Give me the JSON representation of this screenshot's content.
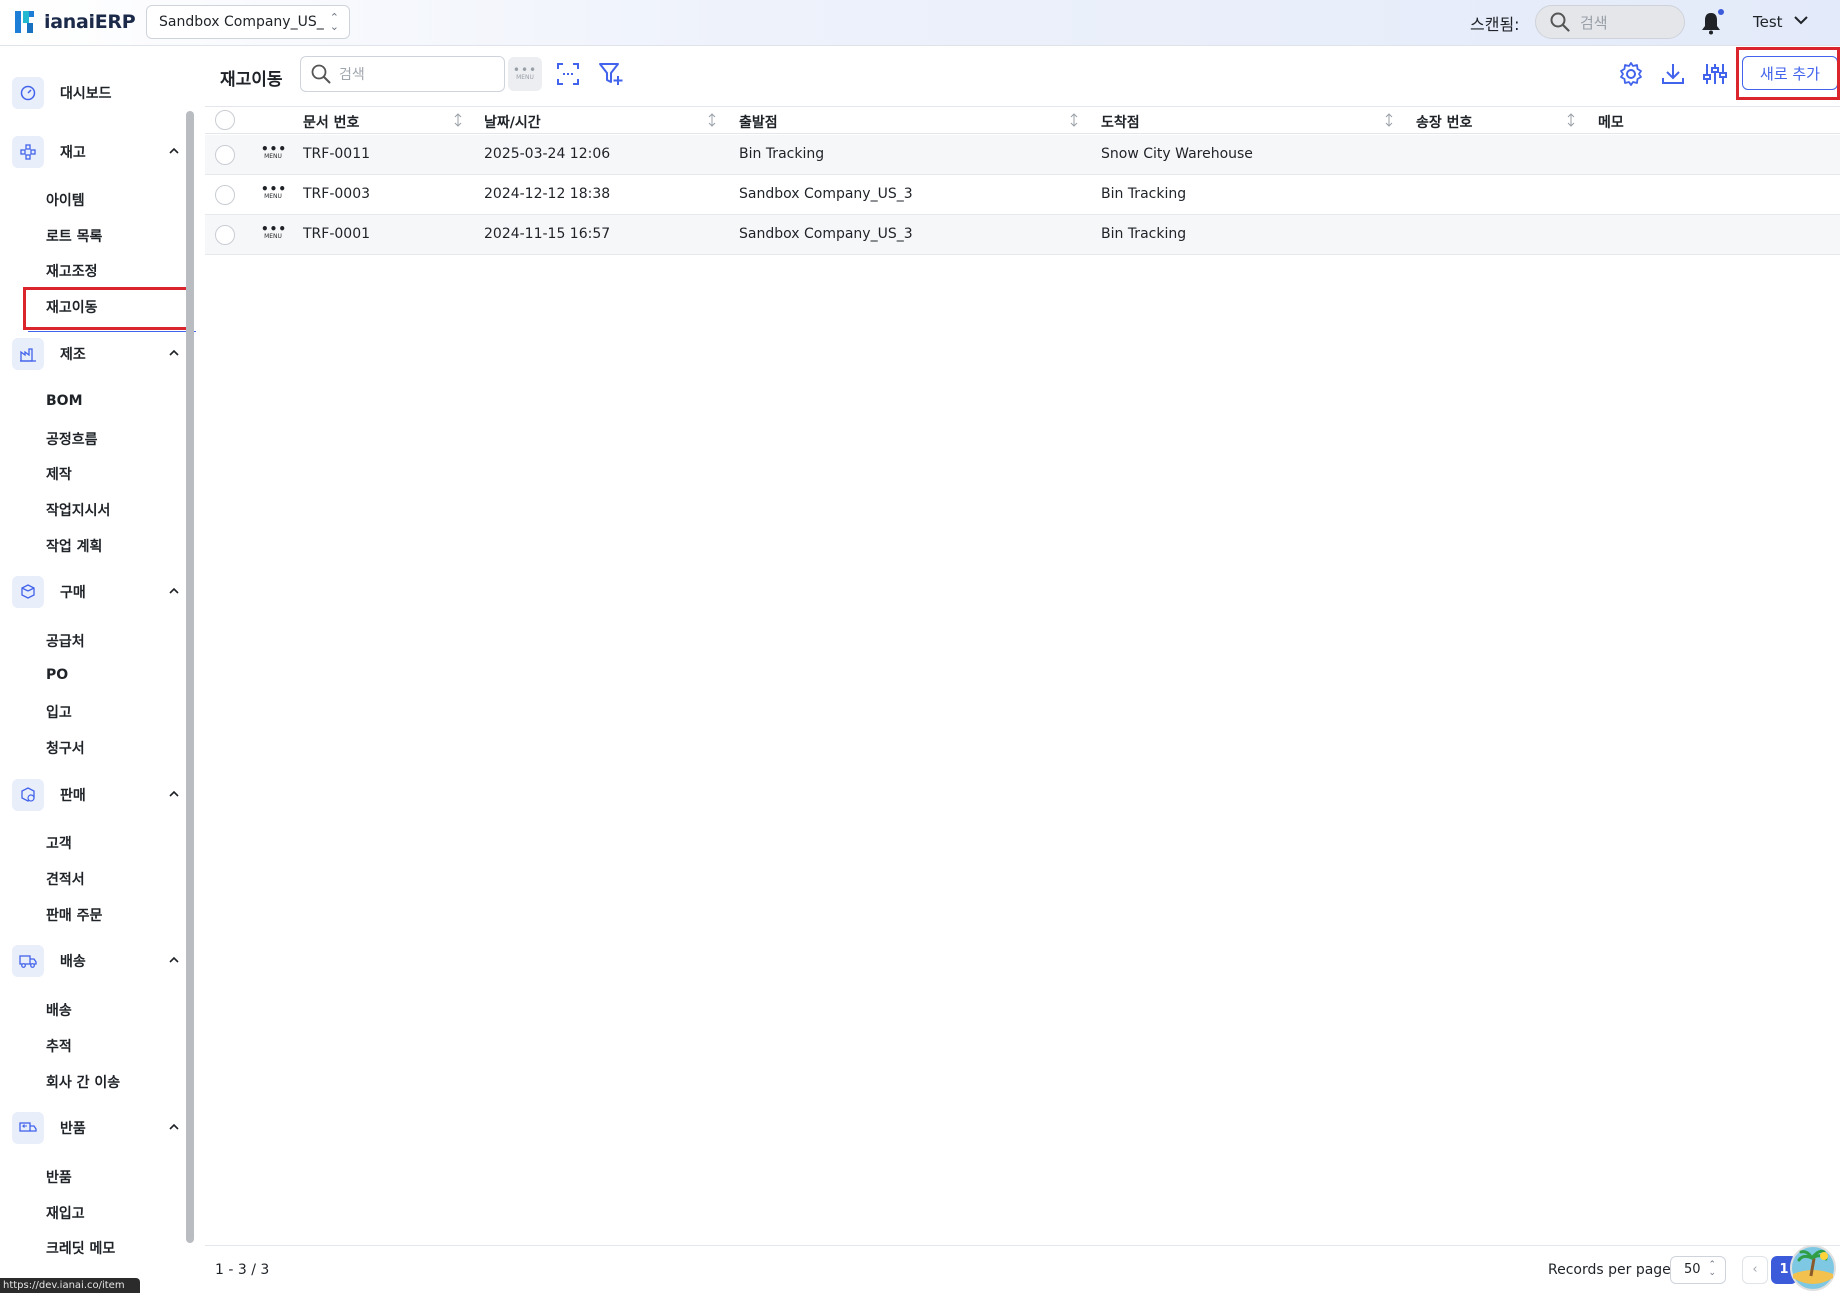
{
  "app": {
    "name": "ianaiERP"
  },
  "header": {
    "company": "Sandbox Company_US_",
    "scan_label": "스캔됨:",
    "search_placeholder": "검색",
    "user": "Test"
  },
  "sidebar": {
    "groups": [
      {
        "label": "대시보드",
        "icon": "dashboard-icon",
        "items": []
      },
      {
        "label": "재고",
        "icon": "inventory-icon",
        "items": [
          "아이템",
          "로트 목록",
          "재고조정",
          "재고이동"
        ]
      },
      {
        "label": "제조",
        "icon": "factory-icon",
        "items": [
          "BOM",
          "공정흐름",
          "제작",
          "작업지시서",
          "작업 계획"
        ]
      },
      {
        "label": "구매",
        "icon": "purchase-icon",
        "items": [
          "공급처",
          "PO",
          "입고",
          "청구서"
        ]
      },
      {
        "label": "판매",
        "icon": "sales-icon",
        "items": [
          "고객",
          "견적서",
          "판매 주문"
        ]
      },
      {
        "label": "배송",
        "icon": "truck-icon",
        "items": [
          "배송",
          "추적",
          "회사 간 이송"
        ]
      },
      {
        "label": "반품",
        "icon": "return-icon",
        "items": [
          "반품",
          "재입고",
          "크레딧 메모"
        ]
      }
    ],
    "active_item": "재고이동"
  },
  "page": {
    "title": "재고이동",
    "search_placeholder": "검색",
    "menu_label": "MENU",
    "add_button": "새로 추가"
  },
  "table": {
    "columns": [
      "문서 번호",
      "날짜/시간",
      "출발점",
      "도착점",
      "송장 번호",
      "메모"
    ],
    "rows": [
      {
        "menu": "MENU",
        "doc": "TRF-0011",
        "datetime": "2025-03-24 12:06",
        "from": "Bin Tracking",
        "to": "Snow City Warehouse",
        "invoice": "",
        "memo": ""
      },
      {
        "menu": "MENU",
        "doc": "TRF-0003",
        "datetime": "2024-12-12 18:38",
        "from": "Sandbox Company_US_3",
        "to": "Bin Tracking",
        "invoice": "",
        "memo": ""
      },
      {
        "menu": "MENU",
        "doc": "TRF-0001",
        "datetime": "2024-11-15 16:57",
        "from": "Sandbox Company_US_3",
        "to": "Bin Tracking",
        "invoice": "",
        "memo": ""
      }
    ]
  },
  "footer": {
    "range": "1 - 3 / 3",
    "records_per_page_label": "Records per page",
    "records_per_page": "50",
    "prev": "‹",
    "current_page": "1"
  },
  "status_url": "https://dev.ianai.co/item",
  "colors": {
    "accent": "#4263eb",
    "highlight": "#d9252b",
    "brand": "#1c7ed6"
  }
}
